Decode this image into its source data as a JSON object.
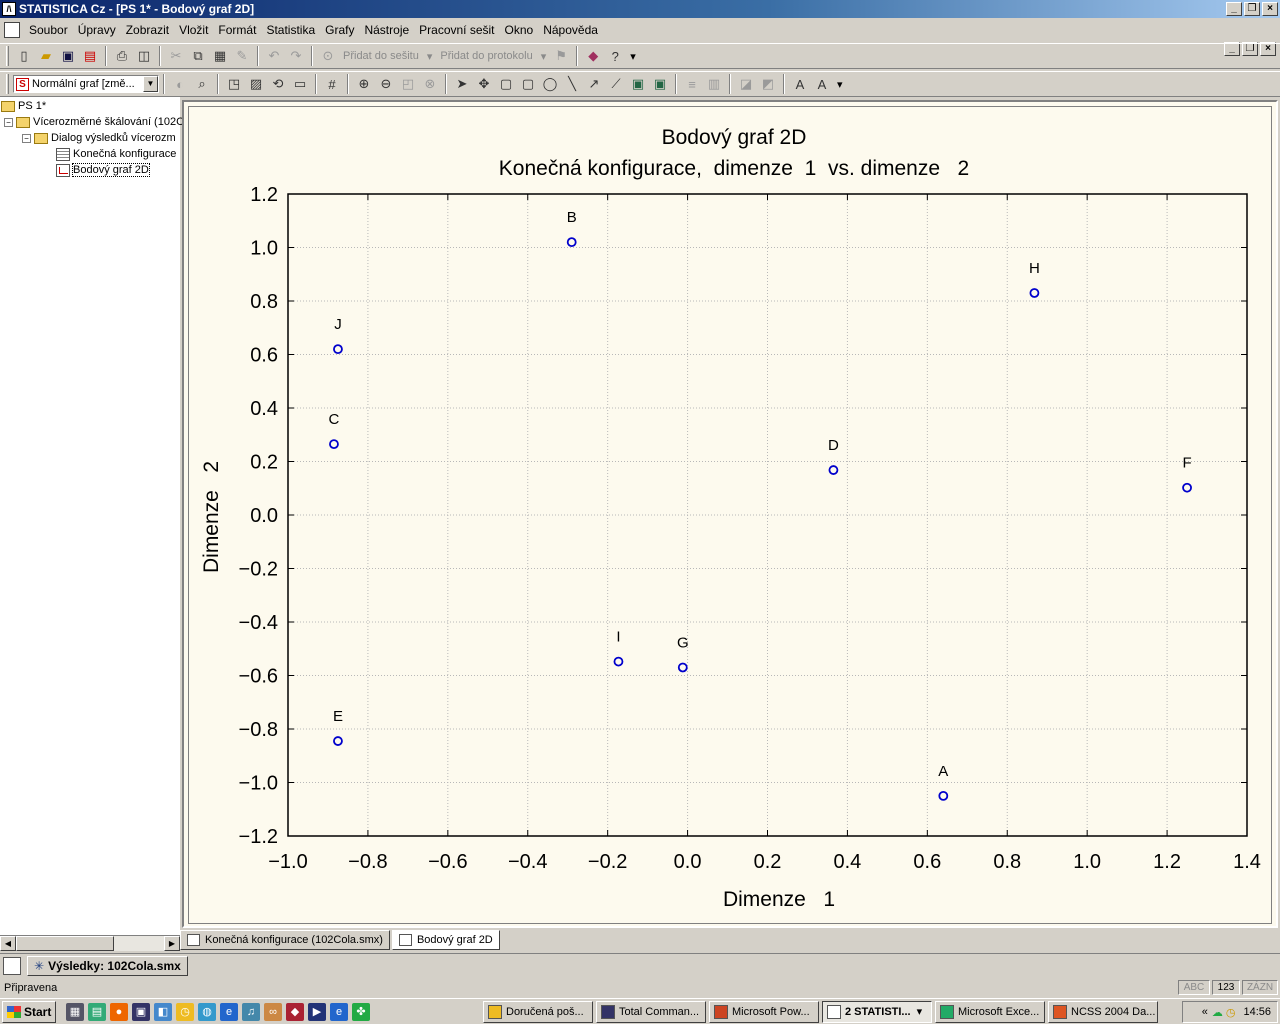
{
  "window": {
    "title": "STATISTICA Cz - [PS 1* - Bodový graf 2D]"
  },
  "menu": [
    "Soubor",
    "Úpravy",
    "Zobrazit",
    "Vložit",
    "Formát",
    "Statistika",
    "Grafy",
    "Nástroje",
    "Pracovní sešit",
    "Okno",
    "Nápověda"
  ],
  "toolbar1": {
    "add_to_workbook": "Přidat do sešitu",
    "add_to_report": "Přidat do protokolu"
  },
  "toolbar2": {
    "graph_type": "Normální graf [změ..."
  },
  "tree": {
    "root": "PS 1*",
    "analysis": "Vícerozměrné škálování (102C",
    "dialog": "Dialog výsledků vícerozm",
    "leaf1": "Konečná konfigurace",
    "leaf2": "Bodový graf 2D"
  },
  "tabs": {
    "tab1": "Konečná konfigurace (102Cola.smx)",
    "tab2": "Bodový graf 2D"
  },
  "results": {
    "label": "Výsledky: 102Cola.smx"
  },
  "status": {
    "text": "Připravena",
    "abc": "ABC",
    "num": "123",
    "rec": "ZÁZN"
  },
  "taskbar": {
    "start": "Start",
    "tasks": [
      "Doručená poš...",
      "Total Comman...",
      "Microsoft Pow...",
      "2 STATISTI...",
      "Microsoft Exce...",
      "NCSS 2004 Da..."
    ],
    "clock": "14:56"
  },
  "chart_data": {
    "type": "scatter",
    "title": "Bodový graf 2D",
    "subtitle": "Konečná konfigurace,  dimenze  1  vs. dimenze   2",
    "xlabel": "Dimenze   1",
    "ylabel": "Dimenze   2",
    "xlim": [
      -1.0,
      1.4
    ],
    "ylim": [
      -1.2,
      1.2
    ],
    "xticks": [
      "−1.0",
      "−0.8",
      "−0.6",
      "−0.4",
      "−0.2",
      "0.0",
      "0.2",
      "0.4",
      "0.6",
      "0.8",
      "1.0",
      "1.2",
      "1.4"
    ],
    "yticks": [
      "1.2",
      "1.0",
      "0.8",
      "0.6",
      "0.4",
      "0.2",
      "0.0",
      "−0.2",
      "−0.4",
      "−0.6",
      "−0.8",
      "−1.0",
      "−1.2"
    ],
    "grid": true,
    "marker_color": "#0000cc",
    "points": [
      {
        "label": "A",
        "x": 0.64,
        "y": -1.05
      },
      {
        "label": "B",
        "x": -0.29,
        "y": 1.02
      },
      {
        "label": "C",
        "x": -0.885,
        "y": 0.265
      },
      {
        "label": "D",
        "x": 0.365,
        "y": 0.168
      },
      {
        "label": "E",
        "x": -0.875,
        "y": -0.845
      },
      {
        "label": "F",
        "x": 1.25,
        "y": 0.102
      },
      {
        "label": "G",
        "x": -0.012,
        "y": -0.57
      },
      {
        "label": "H",
        "x": 0.868,
        "y": 0.83
      },
      {
        "label": "I",
        "x": -0.173,
        "y": -0.548
      },
      {
        "label": "J",
        "x": -0.875,
        "y": 0.62
      }
    ]
  }
}
